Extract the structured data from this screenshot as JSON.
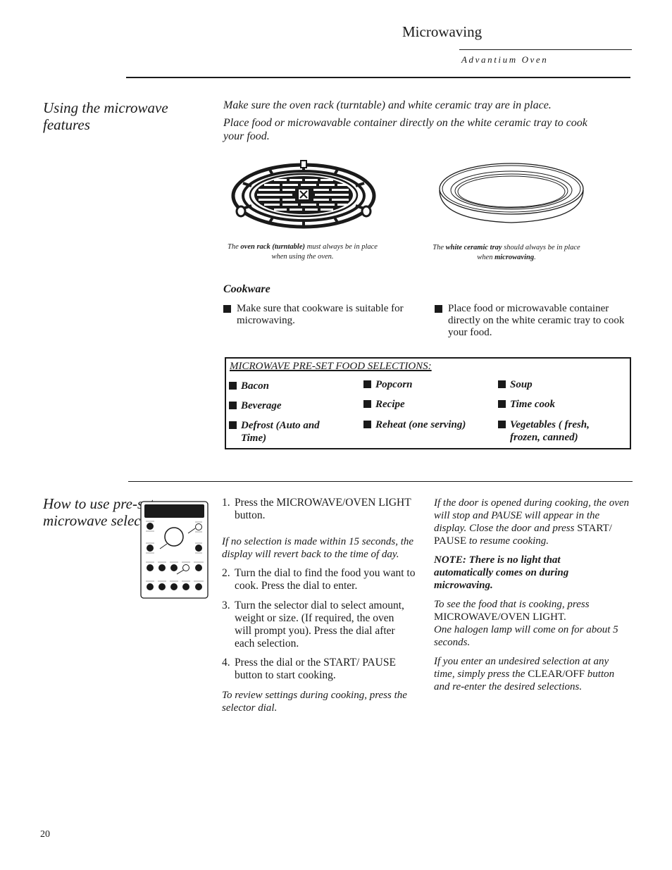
{
  "header": {
    "title": "Microwaving",
    "subtitle": "Advantium Oven"
  },
  "section1": {
    "title": "Using the microwave features",
    "intro": [
      "Make sure the oven rack (turntable) and white ceramic tray are in place.",
      "Place food or microwavable container directly on the white ceramic tray to cook your food."
    ],
    "figures": {
      "rack": {
        "icon": "oven-rack-turntable-illustration",
        "caption_pre": "The ",
        "caption_bold": "oven rack (turntable)",
        "caption_post": " must always be in place when using the oven."
      },
      "tray": {
        "icon": "white-ceramic-tray-illustration",
        "caption_pre": "The ",
        "caption_bold": "white ceramic tray",
        "caption_mid": " should always be in place when ",
        "caption_bold2": "microwaving",
        "caption_post": "."
      }
    },
    "cookware": {
      "title": "Cookware",
      "items": [
        "Make sure that cookware is suitable for microwaving.",
        "Place food or microwavable container directly on the white ceramic tray to cook your food."
      ]
    },
    "presets": {
      "title": "MICROWAVE PRE-SET FOOD SELECTIONS:",
      "columns": [
        [
          "Bacon",
          "Beverage",
          "Defrost (Auto and Time)"
        ],
        [
          "Popcorn",
          "Recipe",
          "Reheat (one serving)"
        ],
        [
          "Soup",
          "Time cook",
          "Vegetables ( fresh, frozen, canned)"
        ]
      ]
    }
  },
  "section2": {
    "title": "How to use pre-set microwave selections",
    "panel_icon": "control-panel-illustration",
    "steps_col": {
      "step1_num": "1.",
      "step1_pre": "Press the ",
      "step1_btn": "MICROWAVE/OVEN LIGHT",
      "step1_post": " button.",
      "note1": "If no selection is made within 15 seconds, the display will revert back to the time of day.",
      "step2_num": "2.",
      "step2": "Turn the dial to find the food you want to cook. Press the dial to enter.",
      "step3_num": "3.",
      "step3": "Turn the selector dial to select amount, weight or size. (If required, the oven will prompt you). Press the dial after each selection.",
      "step4_num": "4.",
      "step4_pre": "Press the dial or the ",
      "step4_btn": "START/ PAUSE",
      "step4_post": " button to start cooking.",
      "note2": "To review settings during cooking, press the selector dial."
    },
    "notes_col": {
      "door_pre": "If the door is opened during cooking, the oven will stop and PAUSE will appear in the display. Close the door and press ",
      "door_btn": "START/ PAUSE",
      "door_post": " to resume cooking.",
      "note": "NOTE: There is no light that automatically comes on during microwaving.",
      "see_pre": "To see the food that is cooking, press ",
      "see_btn": "MICROWAVE/OVEN LIGHT.",
      "see_post": "One halogen lamp will come on for about 5 seconds.",
      "undo_pre": "If you enter an undesired selection at any time, simply press the ",
      "undo_btn": "CLEAR/OFF",
      "undo_post": " button and re-enter the desired selections."
    }
  },
  "page_number": "20"
}
